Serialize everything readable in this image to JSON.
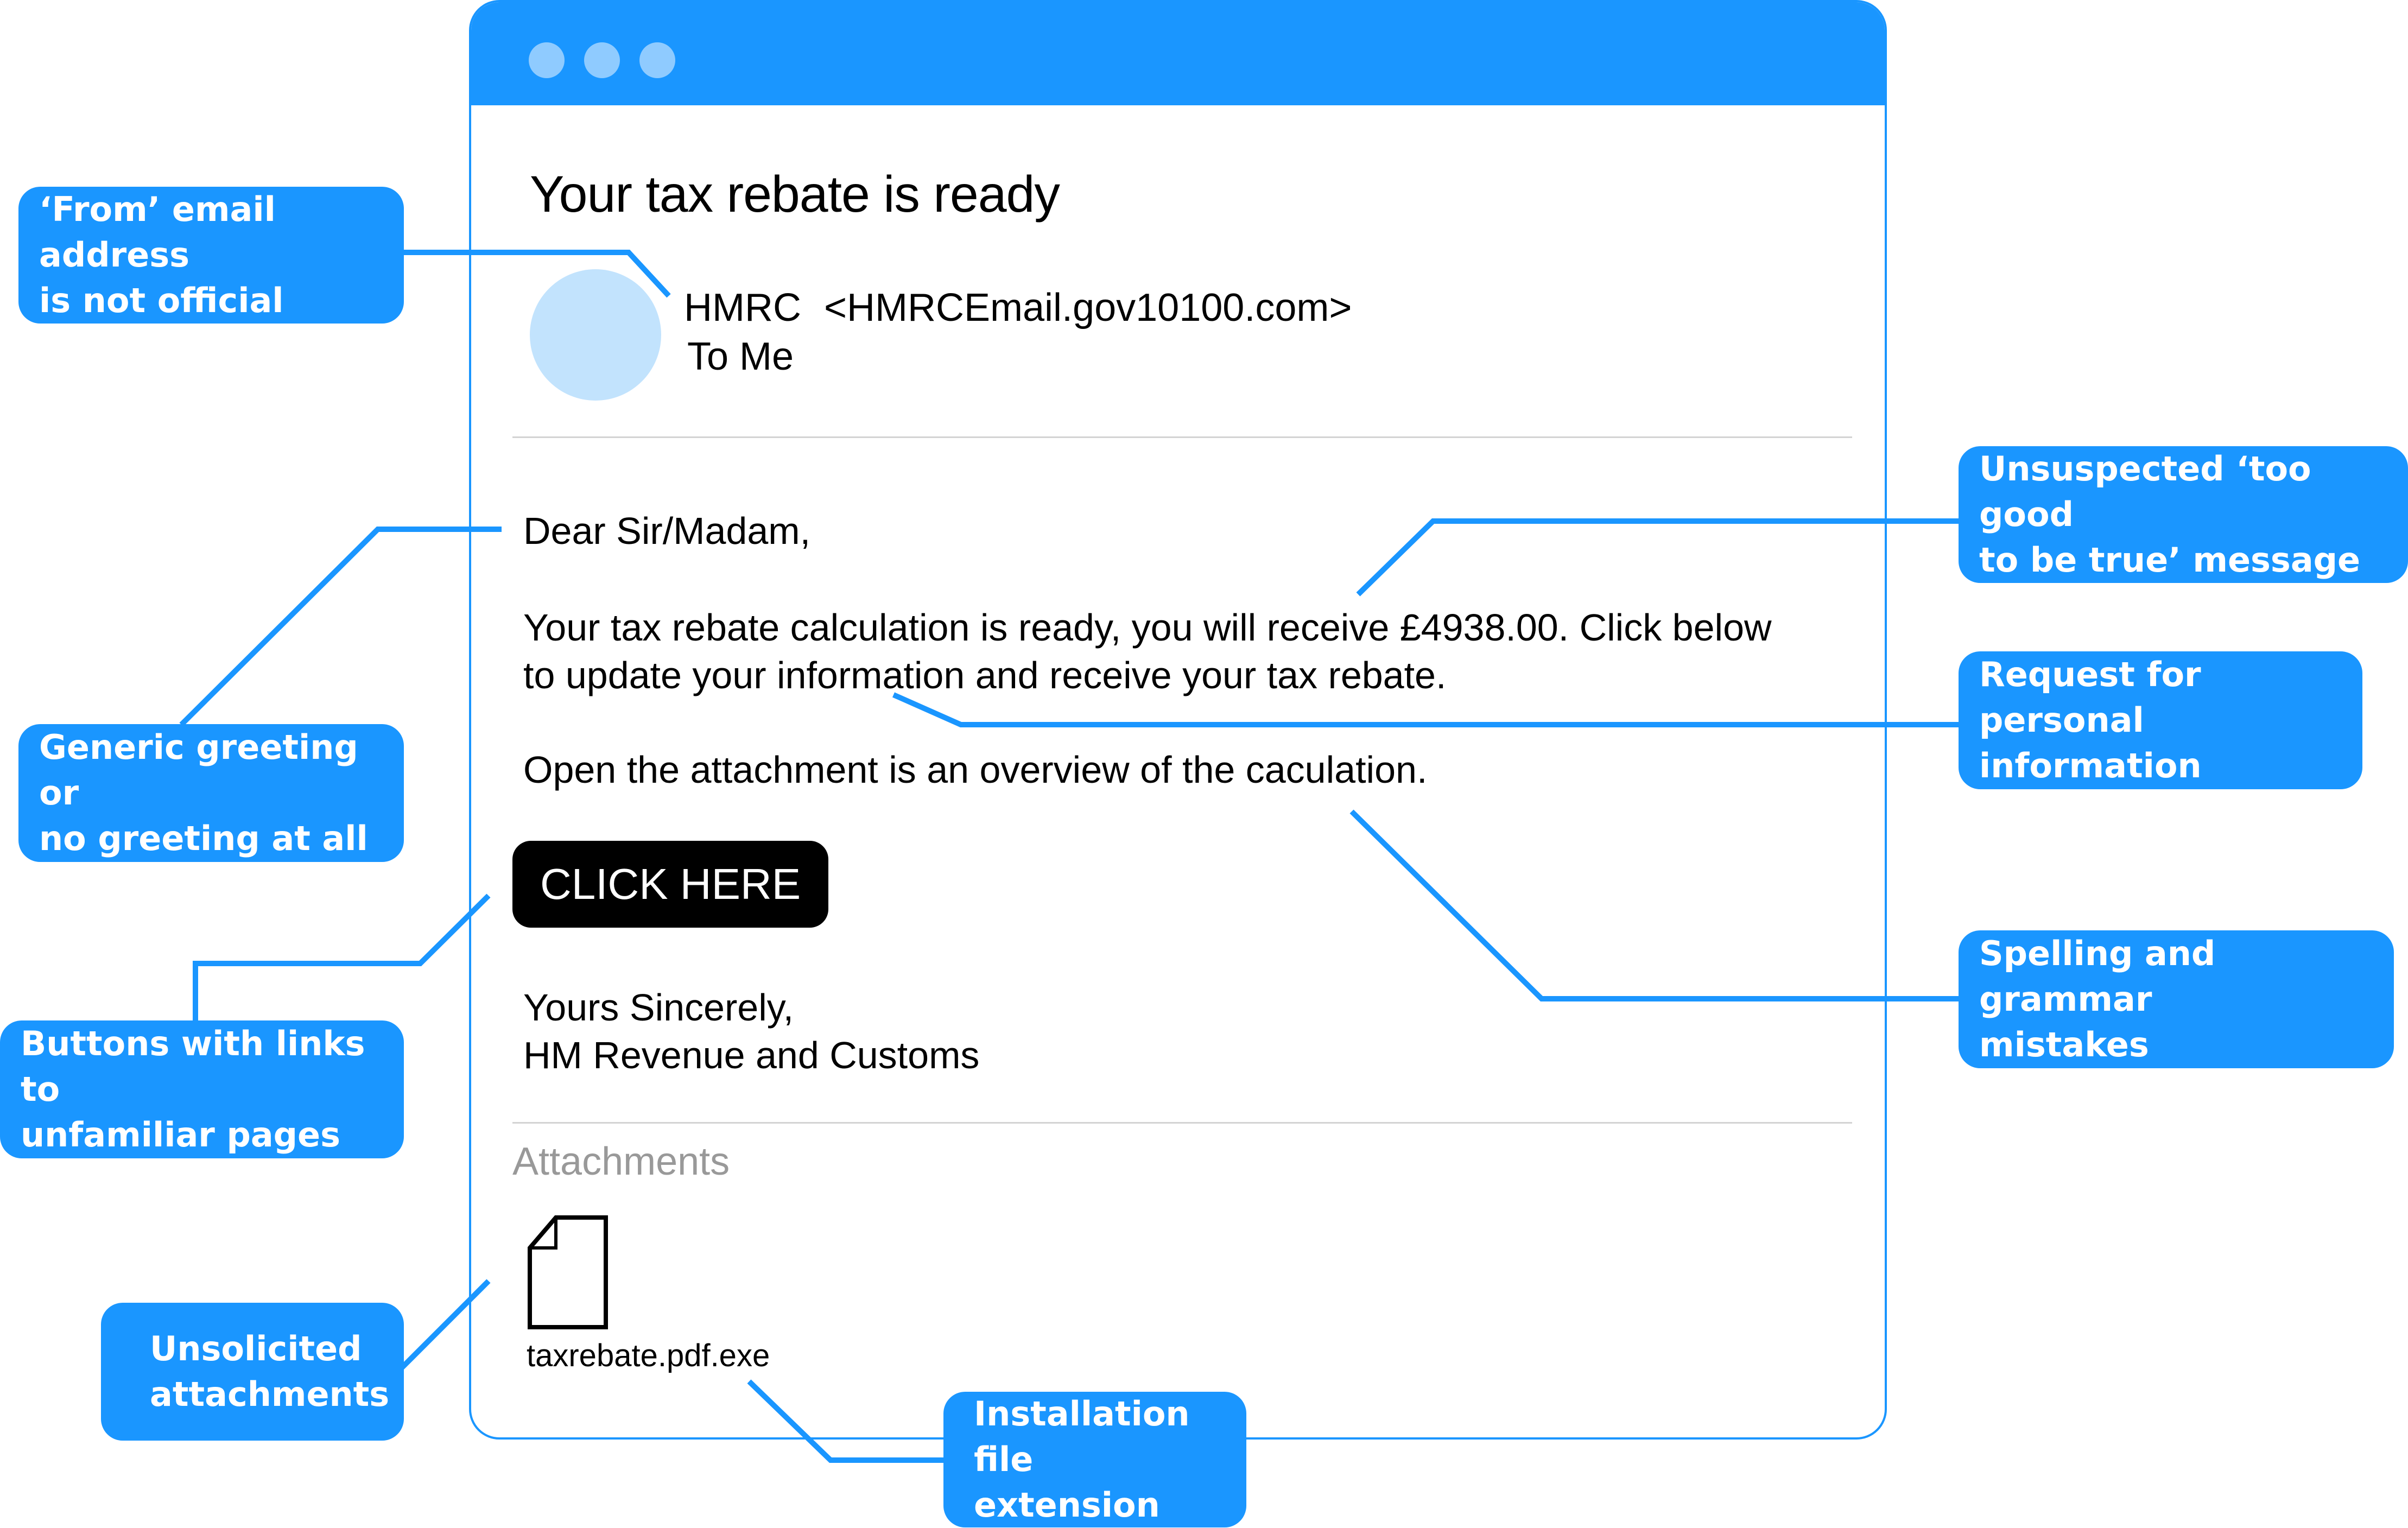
{
  "email": {
    "window_controls": [
      "window-dot",
      "window-dot",
      "window-dot"
    ],
    "subject": "Your tax rebate is ready",
    "sender_name": "HMRC",
    "sender_address": "<HMRCEmail.gov10100.com>",
    "recipient": "To Me",
    "greeting": "Dear Sir/Madam,",
    "paragraph1_line1": "Your tax rebate calculation is ready, you will receive £4938.00. Click below",
    "paragraph1_line2": "to update your information and receive your tax rebate.",
    "paragraph2": "Open the attachment is an overview of the caculation.",
    "cta_label": "CLICK HERE",
    "signoff": "Yours Sincerely,",
    "signature": "HM Revenue and Customs",
    "attachments_label": "Attachments",
    "attachment_icon": "file-icon",
    "attachment_name": "taxrebate.pdf.exe"
  },
  "callouts": {
    "from_address": [
      "‘From’ email address",
      "is not official"
    ],
    "greeting": [
      "Generic greeting or",
      "no greeting at all"
    ],
    "buttons": [
      "Buttons with links to",
      "unfamiliar pages"
    ],
    "attachments": [
      "Unsolicited",
      "attachments"
    ],
    "extension": [
      "Installation file",
      "extension"
    ],
    "too_good": [
      "Unsuspected ‘too good",
      "to be true’ message"
    ],
    "personal_info": [
      "Request for personal",
      "information"
    ],
    "spelling": [
      "Spelling and grammar",
      "mistakes"
    ]
  },
  "colors": {
    "accent": "#1a96ff",
    "dot": "#8fcbff",
    "avatar": "#c2e3fd",
    "cta": "#000000",
    "muted_text": "#999999"
  }
}
